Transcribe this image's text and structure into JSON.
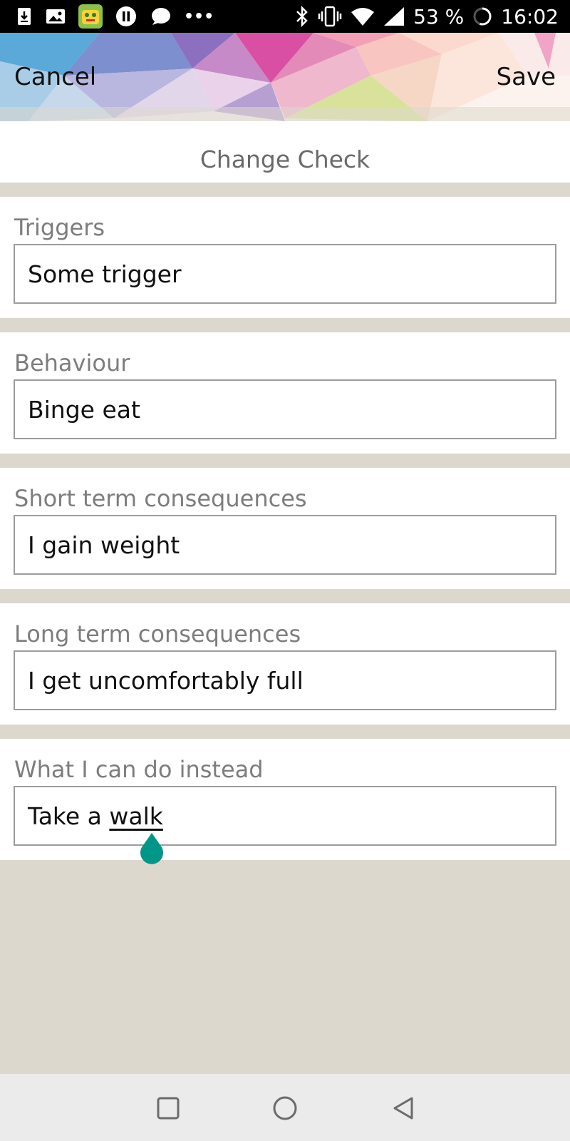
{
  "status_bar": {
    "battery_percent": "53 %",
    "time": "16:02",
    "more_dots": "•••"
  },
  "header": {
    "cancel_label": "Cancel",
    "save_label": "Save"
  },
  "page": {
    "title": "Change Check"
  },
  "sections": [
    {
      "label": "Triggers",
      "value": "Some trigger"
    },
    {
      "label": "Behaviour",
      "value": "Binge eat"
    },
    {
      "label": "Short term consequences",
      "value": "I gain weight"
    },
    {
      "label": "Long term consequences",
      "value": "I get uncomfortably full"
    },
    {
      "label": "What I can do instead",
      "value_prefix": "Take a ",
      "value_underlined": "walk"
    }
  ],
  "colors": {
    "accent": "#009688",
    "background": "#dcd8ce",
    "label_gray": "#7d7d7d",
    "title_gray": "#6a6a6a"
  },
  "icons": {
    "status_left": [
      "download-icon",
      "image-icon",
      "app-icon",
      "pause-icon",
      "chat-icon",
      "more-icon"
    ],
    "status_right": [
      "bluetooth-icon",
      "vibrate-icon",
      "wifi-icon",
      "signal-icon",
      "battery-icon"
    ],
    "nav": [
      "recents-icon",
      "home-icon",
      "back-icon"
    ]
  }
}
